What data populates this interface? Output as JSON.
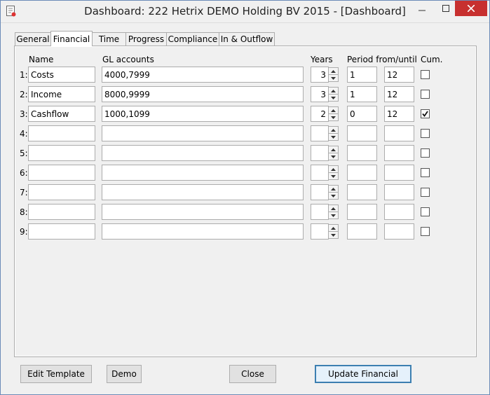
{
  "window": {
    "title": "Dashboard: 222 Hetrix DEMO Holding BV 2015 - [Dashboard]",
    "icons": {
      "app": "document-icon",
      "minimize": "minimize-icon",
      "maximize": "maximize-icon",
      "close": "close-icon"
    }
  },
  "tabs": [
    {
      "label": "General",
      "active": false
    },
    {
      "label": "Financial",
      "active": true
    },
    {
      "label": "Time",
      "active": false
    },
    {
      "label": "Progress",
      "active": false
    },
    {
      "label": "Compliance",
      "active": false
    },
    {
      "label": "In & Outflow",
      "active": false
    }
  ],
  "headers": {
    "name": "Name",
    "gl": "GL accounts",
    "years": "Years",
    "period": "Period from/until",
    "cum": "Cum."
  },
  "rows": [
    {
      "label": "1:",
      "name": "Costs",
      "gl": "4000,7999",
      "years": "3",
      "from": "1",
      "until": "12",
      "cum": false
    },
    {
      "label": "2:",
      "name": "Income",
      "gl": "8000,9999",
      "years": "3",
      "from": "1",
      "until": "12",
      "cum": false
    },
    {
      "label": "3:",
      "name": "Cashflow",
      "gl": "1000,1099",
      "years": "2",
      "from": "0",
      "until": "12",
      "cum": true
    },
    {
      "label": "4:",
      "name": "",
      "gl": "",
      "years": "",
      "from": "",
      "until": "",
      "cum": false
    },
    {
      "label": "5:",
      "name": "",
      "gl": "",
      "years": "",
      "from": "",
      "until": "",
      "cum": false
    },
    {
      "label": "6:",
      "name": "",
      "gl": "",
      "years": "",
      "from": "",
      "until": "",
      "cum": false
    },
    {
      "label": "7:",
      "name": "",
      "gl": "",
      "years": "",
      "from": "",
      "until": "",
      "cum": false
    },
    {
      "label": "8:",
      "name": "",
      "gl": "",
      "years": "",
      "from": "",
      "until": "",
      "cum": false
    },
    {
      "label": "9:",
      "name": "",
      "gl": "",
      "years": "",
      "from": "",
      "until": "",
      "cum": false
    }
  ],
  "buttons": {
    "edit_template": "Edit Template",
    "demo": "Demo",
    "close": "Close",
    "update": "Update Financial"
  },
  "colors": {
    "close_bg": "#c7302f",
    "default_border": "#3c7fb1"
  }
}
